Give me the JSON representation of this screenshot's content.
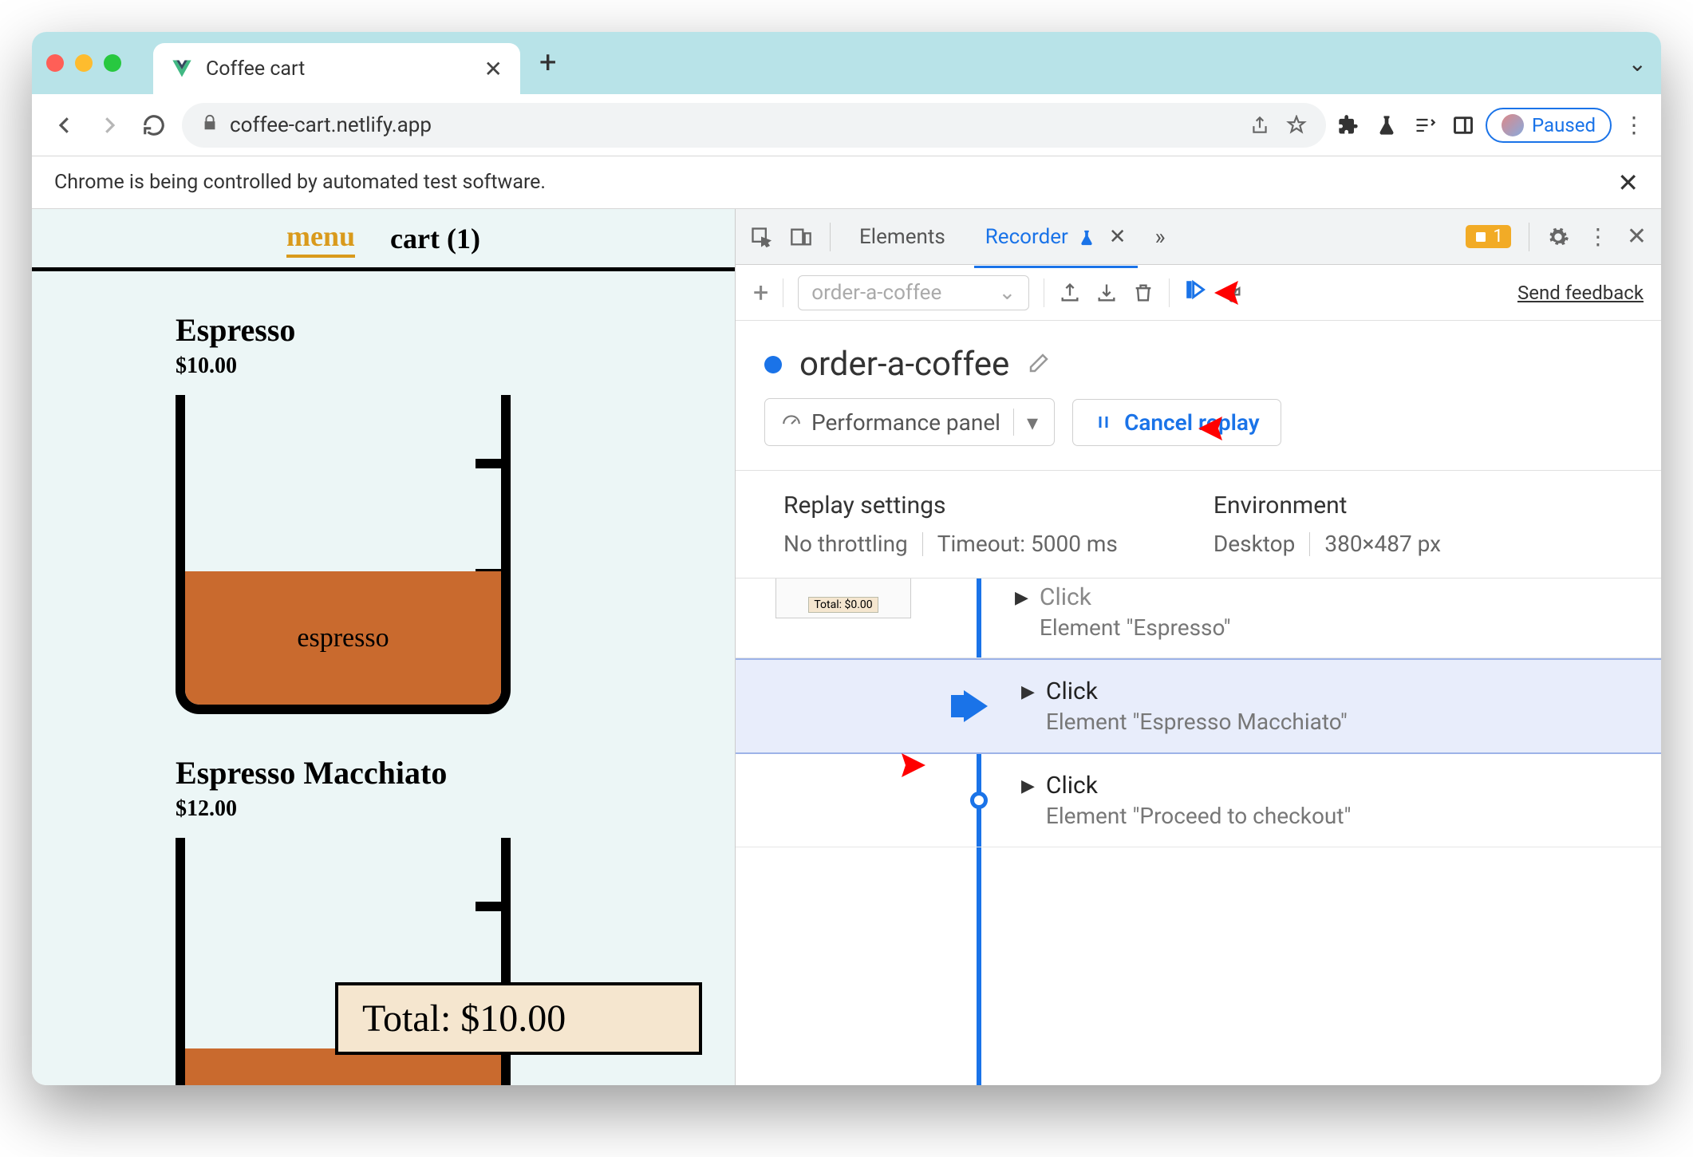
{
  "browser": {
    "tab_title": "Coffee cart",
    "url": "coffee-cart.netlify.app",
    "paused_label": "Paused",
    "infobar_text": "Chrome is being controlled by automated test software."
  },
  "page": {
    "nav": {
      "menu": "menu",
      "cart": "cart (1)"
    },
    "products": [
      {
        "name": "Espresso",
        "price": "$10.00",
        "fill_label": "espresso"
      },
      {
        "name": "Espresso Macchiato",
        "price": "$12.00",
        "fill_label": ""
      }
    ],
    "total_overlay": "Total: $10.00"
  },
  "devtools": {
    "tabs": {
      "elements": "Elements",
      "recorder": "Recorder"
    },
    "issue_count": "1",
    "rec_toolbar": {
      "recording_name": "order-a-coffee",
      "feedback": "Send feedback"
    },
    "title": "order-a-coffee",
    "buttons": {
      "performance": "Performance panel",
      "cancel": "Cancel replay"
    },
    "settings": {
      "replay_header": "Replay settings",
      "throttling": "No throttling",
      "timeout": "Timeout: 5000 ms",
      "env_header": "Environment",
      "device": "Desktop",
      "viewport": "380×487 px"
    },
    "steps": [
      {
        "thumb": "Total: $0.00",
        "action": "Click",
        "element": "Element \"Espresso\""
      },
      {
        "thumb": "",
        "action": "Click",
        "element": "Element \"Espresso Macchiato\""
      },
      {
        "thumb": "",
        "action": "Click",
        "element": "Element \"Proceed to checkout\""
      }
    ]
  }
}
